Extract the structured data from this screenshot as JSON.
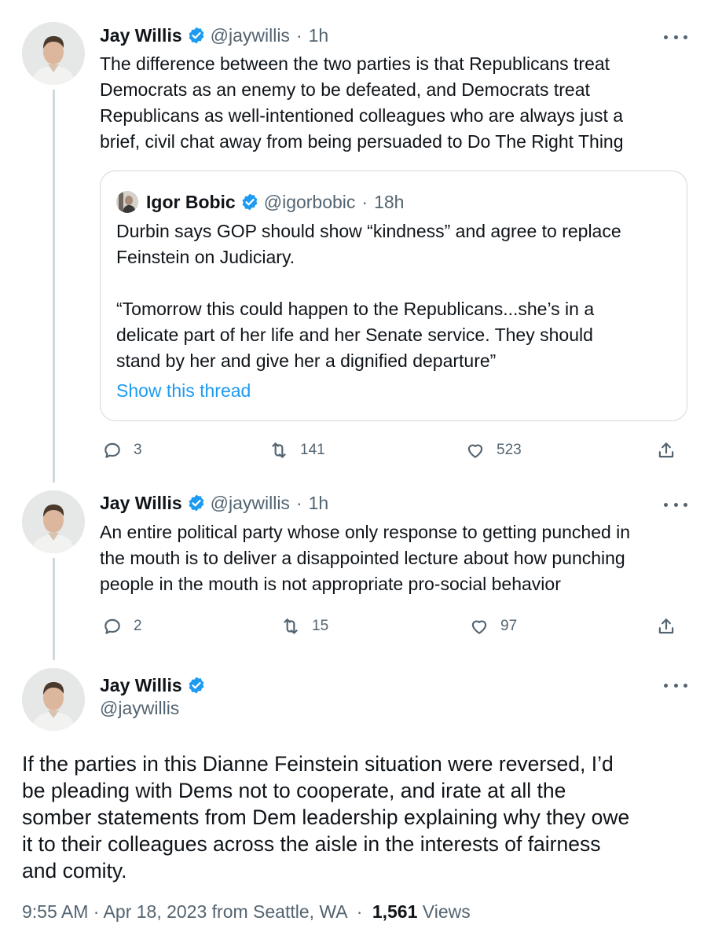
{
  "tweet1": {
    "name": "Jay Willis",
    "handle": "@jaywillis",
    "separator": "·",
    "time": "1h",
    "text_lines": [
      "The difference between the two parties is that Republicans treat",
      "Democrats as an enemy to be defeated, and Democrats treat",
      "Republicans as well-intentioned colleagues who are always just a",
      "brief, civil chat away from being persuaded to Do The Right Thing"
    ],
    "quote": {
      "name": "Igor Bobic",
      "handle": "@igorbobic",
      "separator": "·",
      "time": "18h",
      "text_lines": [
        "Durbin says GOP should show “kindness” and agree to replace",
        "Feinstein on Judiciary.",
        "",
        "“Tomorrow this could happen to the Republicans...she’s in a",
        "delicate part of her life and her Senate service. They should",
        "stand by her and give her a dignified departure”"
      ],
      "show_thread": "Show this thread"
    },
    "replies": "3",
    "retweets": "141",
    "likes": "523"
  },
  "tweet2": {
    "name": "Jay Willis",
    "handle": "@jaywillis",
    "separator": "·",
    "time": "1h",
    "text_lines": [
      "An entire political party whose only response to getting punched in",
      "the mouth is to deliver a disappointed lecture about how punching",
      "people in the mouth is not appropriate pro-social behavior"
    ],
    "replies": "2",
    "retweets": "15",
    "likes": "97"
  },
  "main_tweet": {
    "name": "Jay Willis",
    "handle": "@jaywillis",
    "text_lines": [
      "If the parties in this Dianne Feinstein situation were reversed, I’d",
      "be pleading with Dems not to cooperate, and irate at all the",
      "somber statements from Dem leadership explaining why they owe",
      "it to their colleagues across the aisle in the interests of fairness",
      "and comity."
    ],
    "timestamp": "9:55 AM · Apr 18, 2023 from Seattle, WA",
    "separator": "·",
    "views_count": "1,561",
    "views_label": "Views"
  },
  "icons": {
    "verified": "verified-badge-icon",
    "more": "more-options-icon",
    "reply": "reply-icon",
    "retweet": "retweet-icon",
    "like": "like-icon",
    "share": "share-icon"
  },
  "colors": {
    "accent": "#1d9bf0",
    "text": "#0f1419",
    "secondary": "#536471",
    "border": "#cfd9de"
  }
}
